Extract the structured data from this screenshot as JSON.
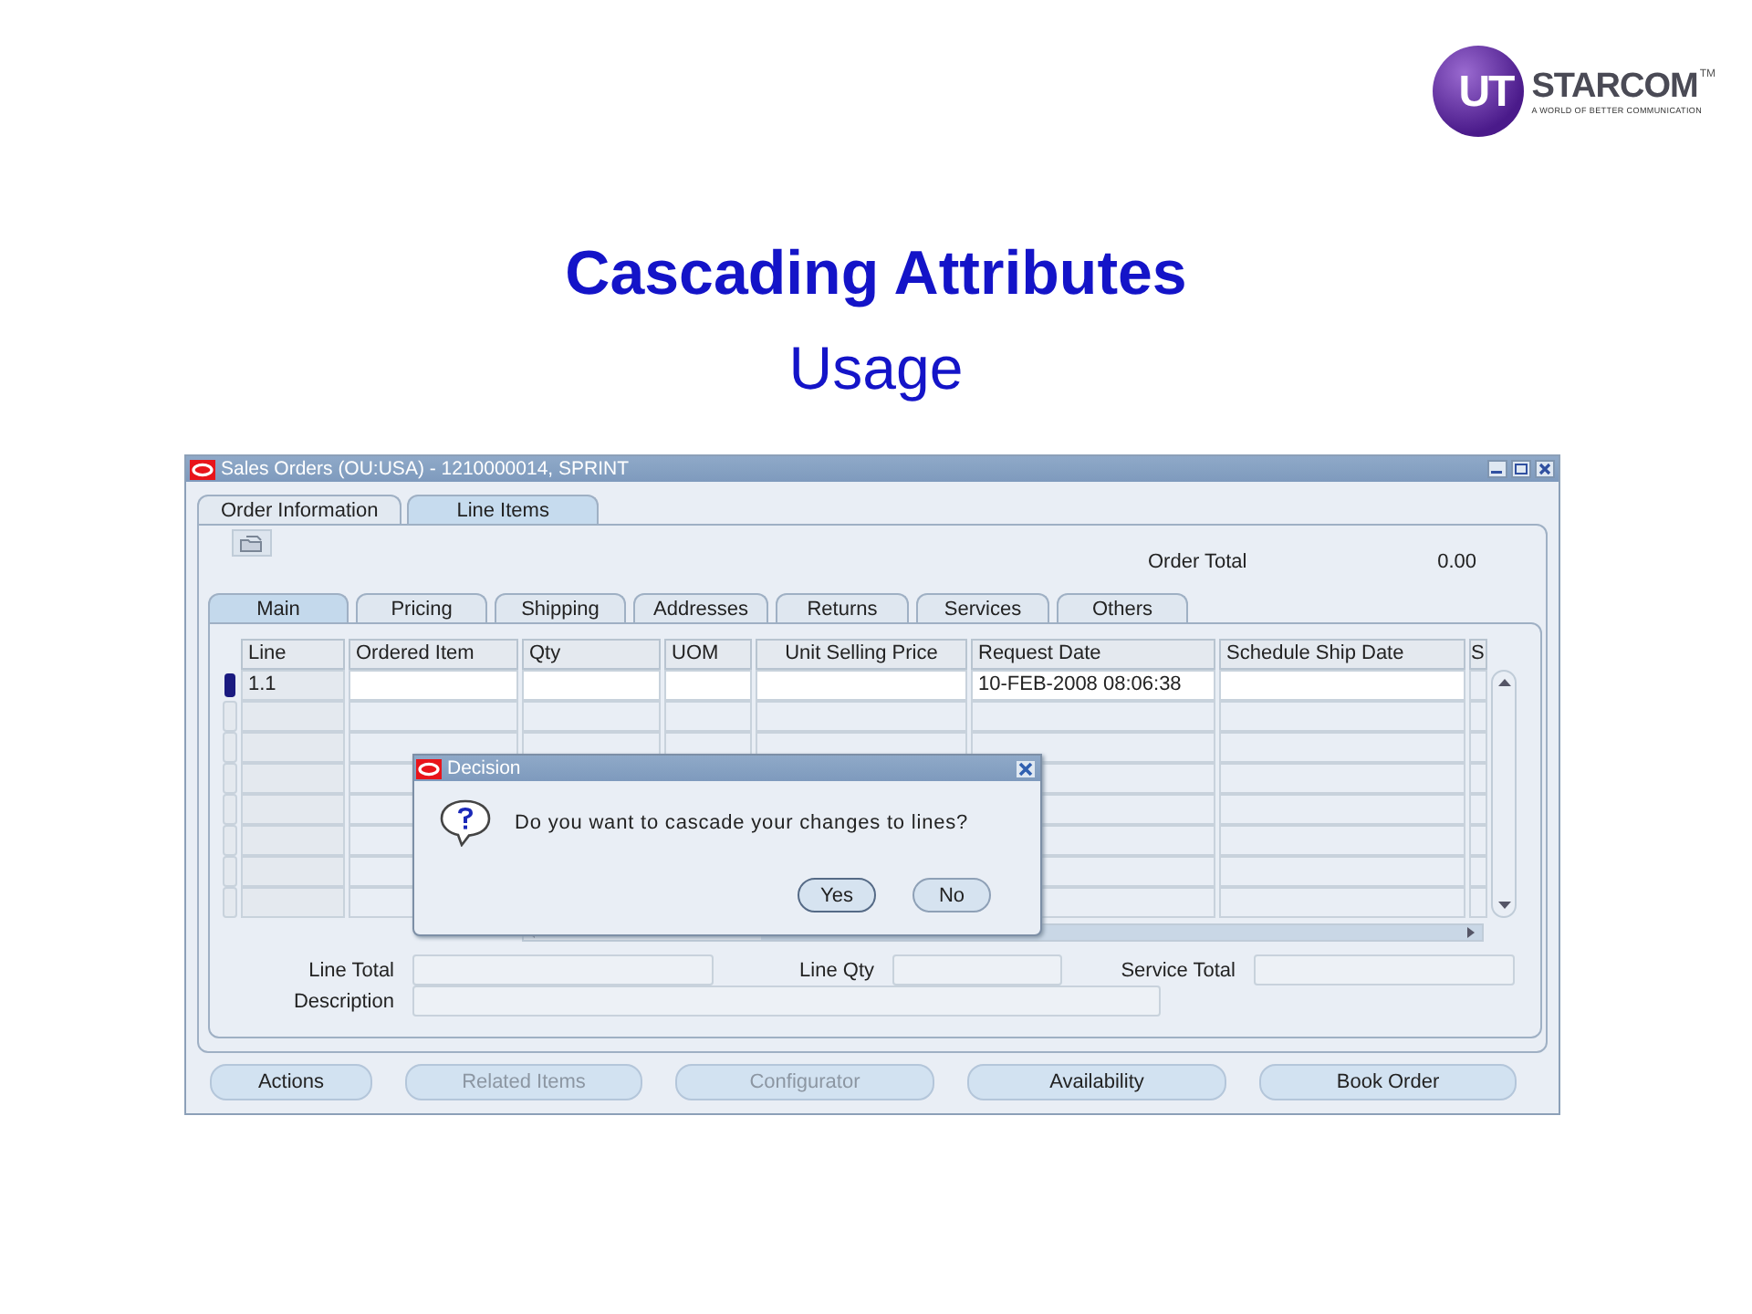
{
  "logo": {
    "mark": "UT",
    "name": "STARCOM",
    "tm": "TM",
    "tagline": "A WORLD OF BETTER COMMUNICATION"
  },
  "slide": {
    "title": "Cascading Attributes",
    "subtitle": "Usage"
  },
  "window": {
    "title": "Sales Orders (OU:USA) - 1210000014, SPRINT"
  },
  "tabs": [
    {
      "label": "Order Information",
      "selected": false
    },
    {
      "label": "Line Items",
      "selected": true
    }
  ],
  "order_total": {
    "label": "Order Total",
    "value": "0.00"
  },
  "subtabs": [
    {
      "label": "Main",
      "selected": true
    },
    {
      "label": "Pricing",
      "selected": false
    },
    {
      "label": "Shipping",
      "selected": false
    },
    {
      "label": "Addresses",
      "selected": false
    },
    {
      "label": "Returns",
      "selected": false
    },
    {
      "label": "Services",
      "selected": false
    },
    {
      "label": "Others",
      "selected": false
    }
  ],
  "table": {
    "columns": [
      "Line",
      "Ordered Item",
      "Qty",
      "UOM",
      "Unit Selling Price",
      "Request Date",
      "Schedule Ship Date",
      "S"
    ],
    "rows": [
      {
        "selected": true,
        "cells": [
          "1.1",
          null,
          null,
          null,
          null,
          "10-FEB-2008 08:06:38",
          null,
          null
        ]
      }
    ]
  },
  "dialog": {
    "title": "Decision",
    "message": "Do you want to cascade your changes to lines?",
    "buttons": [
      {
        "label": "Yes",
        "focused": true
      },
      {
        "label": "No",
        "focused": false
      }
    ]
  },
  "totals": [
    {
      "label": "Line Total"
    },
    {
      "label": "Line Qty"
    },
    {
      "label": "Service Total"
    },
    {
      "label": "Description"
    }
  ],
  "buttons": [
    {
      "label": "Actions",
      "disabled": false
    },
    {
      "label": "Related Items",
      "disabled": true
    },
    {
      "label": "Configurator",
      "disabled": true
    },
    {
      "label": "Availability",
      "disabled": false
    },
    {
      "label": "Book Order",
      "disabled": false
    }
  ]
}
